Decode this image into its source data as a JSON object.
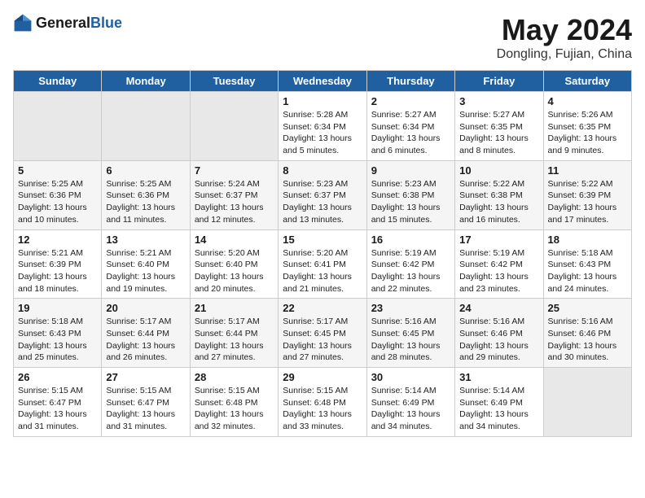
{
  "header": {
    "logo_general": "General",
    "logo_blue": "Blue",
    "month_title": "May 2024",
    "subtitle": "Dongling, Fujian, China"
  },
  "days_of_week": [
    "Sunday",
    "Monday",
    "Tuesday",
    "Wednesday",
    "Thursday",
    "Friday",
    "Saturday"
  ],
  "weeks": [
    [
      {
        "day": "",
        "info": ""
      },
      {
        "day": "",
        "info": ""
      },
      {
        "day": "",
        "info": ""
      },
      {
        "day": "1",
        "info": "Sunrise: 5:28 AM\nSunset: 6:34 PM\nDaylight: 13 hours\nand 5 minutes."
      },
      {
        "day": "2",
        "info": "Sunrise: 5:27 AM\nSunset: 6:34 PM\nDaylight: 13 hours\nand 6 minutes."
      },
      {
        "day": "3",
        "info": "Sunrise: 5:27 AM\nSunset: 6:35 PM\nDaylight: 13 hours\nand 8 minutes."
      },
      {
        "day": "4",
        "info": "Sunrise: 5:26 AM\nSunset: 6:35 PM\nDaylight: 13 hours\nand 9 minutes."
      }
    ],
    [
      {
        "day": "5",
        "info": "Sunrise: 5:25 AM\nSunset: 6:36 PM\nDaylight: 13 hours\nand 10 minutes."
      },
      {
        "day": "6",
        "info": "Sunrise: 5:25 AM\nSunset: 6:36 PM\nDaylight: 13 hours\nand 11 minutes."
      },
      {
        "day": "7",
        "info": "Sunrise: 5:24 AM\nSunset: 6:37 PM\nDaylight: 13 hours\nand 12 minutes."
      },
      {
        "day": "8",
        "info": "Sunrise: 5:23 AM\nSunset: 6:37 PM\nDaylight: 13 hours\nand 13 minutes."
      },
      {
        "day": "9",
        "info": "Sunrise: 5:23 AM\nSunset: 6:38 PM\nDaylight: 13 hours\nand 15 minutes."
      },
      {
        "day": "10",
        "info": "Sunrise: 5:22 AM\nSunset: 6:38 PM\nDaylight: 13 hours\nand 16 minutes."
      },
      {
        "day": "11",
        "info": "Sunrise: 5:22 AM\nSunset: 6:39 PM\nDaylight: 13 hours\nand 17 minutes."
      }
    ],
    [
      {
        "day": "12",
        "info": "Sunrise: 5:21 AM\nSunset: 6:39 PM\nDaylight: 13 hours\nand 18 minutes."
      },
      {
        "day": "13",
        "info": "Sunrise: 5:21 AM\nSunset: 6:40 PM\nDaylight: 13 hours\nand 19 minutes."
      },
      {
        "day": "14",
        "info": "Sunrise: 5:20 AM\nSunset: 6:40 PM\nDaylight: 13 hours\nand 20 minutes."
      },
      {
        "day": "15",
        "info": "Sunrise: 5:20 AM\nSunset: 6:41 PM\nDaylight: 13 hours\nand 21 minutes."
      },
      {
        "day": "16",
        "info": "Sunrise: 5:19 AM\nSunset: 6:42 PM\nDaylight: 13 hours\nand 22 minutes."
      },
      {
        "day": "17",
        "info": "Sunrise: 5:19 AM\nSunset: 6:42 PM\nDaylight: 13 hours\nand 23 minutes."
      },
      {
        "day": "18",
        "info": "Sunrise: 5:18 AM\nSunset: 6:43 PM\nDaylight: 13 hours\nand 24 minutes."
      }
    ],
    [
      {
        "day": "19",
        "info": "Sunrise: 5:18 AM\nSunset: 6:43 PM\nDaylight: 13 hours\nand 25 minutes."
      },
      {
        "day": "20",
        "info": "Sunrise: 5:17 AM\nSunset: 6:44 PM\nDaylight: 13 hours\nand 26 minutes."
      },
      {
        "day": "21",
        "info": "Sunrise: 5:17 AM\nSunset: 6:44 PM\nDaylight: 13 hours\nand 27 minutes."
      },
      {
        "day": "22",
        "info": "Sunrise: 5:17 AM\nSunset: 6:45 PM\nDaylight: 13 hours\nand 27 minutes."
      },
      {
        "day": "23",
        "info": "Sunrise: 5:16 AM\nSunset: 6:45 PM\nDaylight: 13 hours\nand 28 minutes."
      },
      {
        "day": "24",
        "info": "Sunrise: 5:16 AM\nSunset: 6:46 PM\nDaylight: 13 hours\nand 29 minutes."
      },
      {
        "day": "25",
        "info": "Sunrise: 5:16 AM\nSunset: 6:46 PM\nDaylight: 13 hours\nand 30 minutes."
      }
    ],
    [
      {
        "day": "26",
        "info": "Sunrise: 5:15 AM\nSunset: 6:47 PM\nDaylight: 13 hours\nand 31 minutes."
      },
      {
        "day": "27",
        "info": "Sunrise: 5:15 AM\nSunset: 6:47 PM\nDaylight: 13 hours\nand 31 minutes."
      },
      {
        "day": "28",
        "info": "Sunrise: 5:15 AM\nSunset: 6:48 PM\nDaylight: 13 hours\nand 32 minutes."
      },
      {
        "day": "29",
        "info": "Sunrise: 5:15 AM\nSunset: 6:48 PM\nDaylight: 13 hours\nand 33 minutes."
      },
      {
        "day": "30",
        "info": "Sunrise: 5:14 AM\nSunset: 6:49 PM\nDaylight: 13 hours\nand 34 minutes."
      },
      {
        "day": "31",
        "info": "Sunrise: 5:14 AM\nSunset: 6:49 PM\nDaylight: 13 hours\nand 34 minutes."
      },
      {
        "day": "",
        "info": ""
      }
    ]
  ]
}
